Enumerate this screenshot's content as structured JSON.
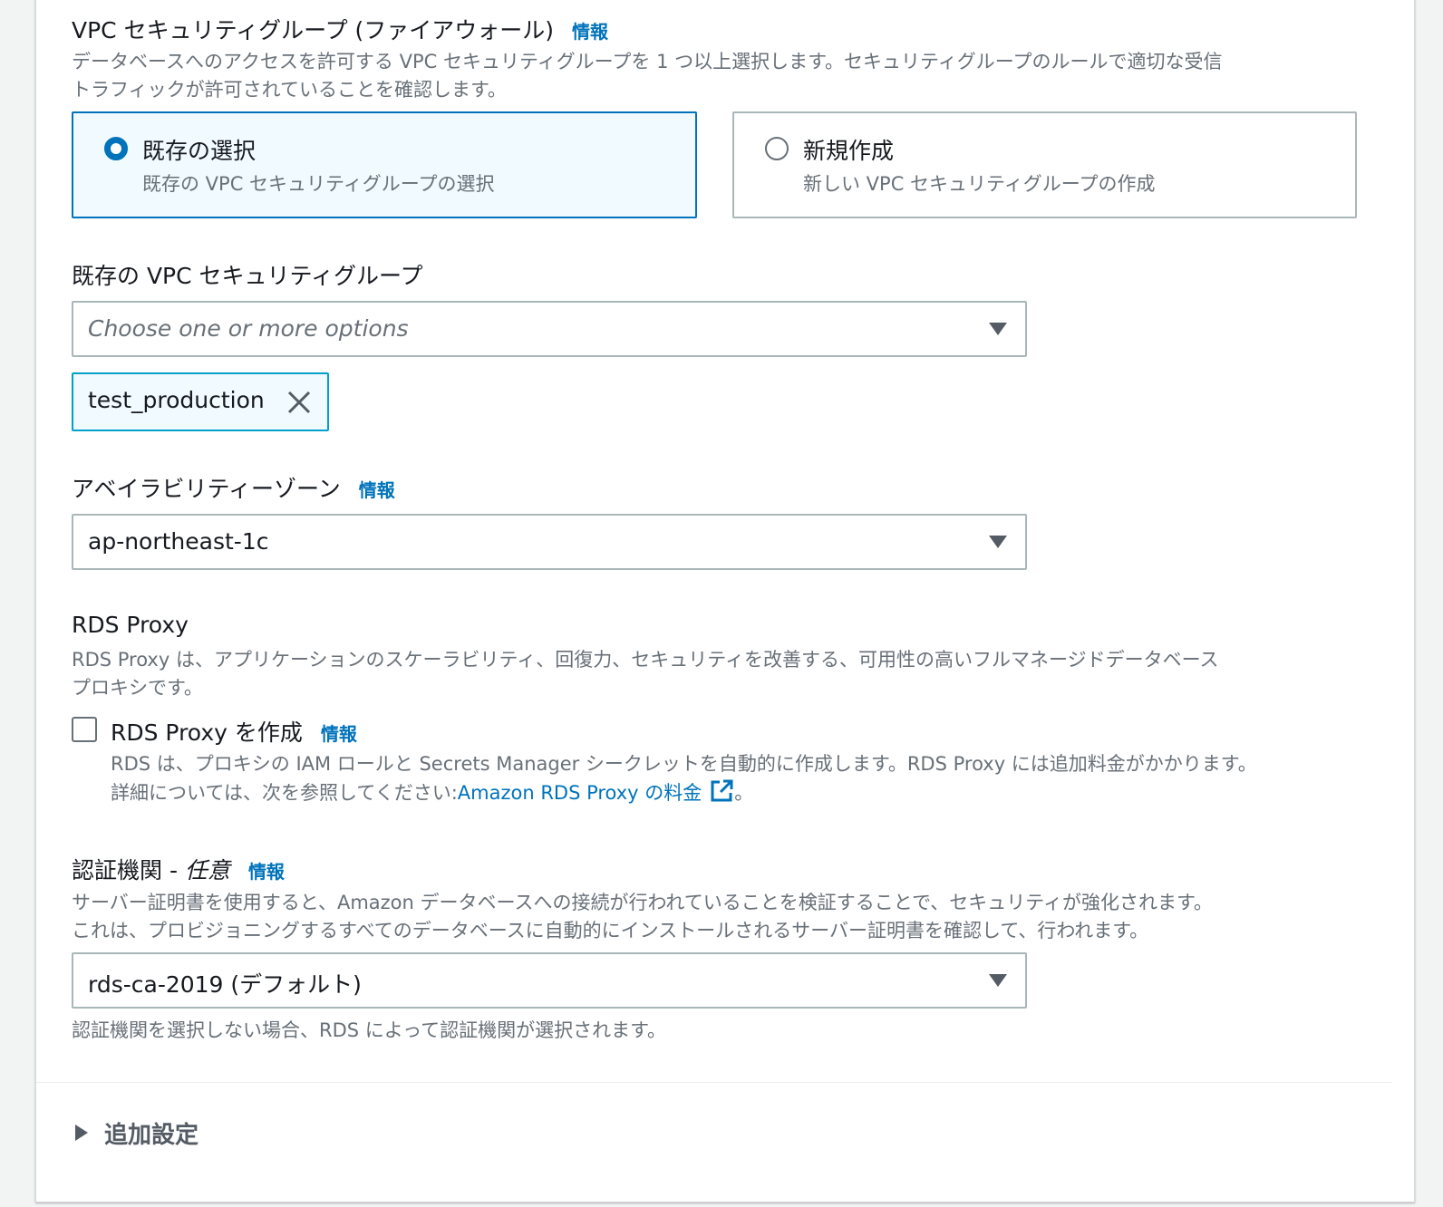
{
  "security_group": {
    "label": "VPC セキュリティグループ (ファイアウォール)",
    "info": "情報",
    "description_line1": "データベースへのアクセスを許可する VPC セキュリティグループを 1 つ以上選択します。セキュリティグループのルールで適切な受信",
    "description_line2": "トラフィックが許可されていることを確認します。",
    "options": [
      {
        "title": "既存の選択",
        "description": "既存の VPC セキュリティグループの選択",
        "selected": true
      },
      {
        "title": "新規作成",
        "description": "新しい VPC セキュリティグループの作成",
        "selected": false
      }
    ]
  },
  "existing_sg": {
    "label": "既存の VPC セキュリティグループ",
    "placeholder": "Choose one or more options",
    "tokens": [
      "test_production"
    ]
  },
  "availability_zone": {
    "label": "アベイラビリティーゾーン",
    "info": "情報",
    "value": "ap-northeast-1c"
  },
  "rds_proxy": {
    "label": "RDS Proxy",
    "description_line1": "RDS Proxy は、アプリケーションのスケーラビリティ、回復力、セキュリティを改善する、可用性の高いフルマネージドデータベース",
    "description_line2": "プロキシです。",
    "checkbox_label": "RDS Proxy を作成",
    "checked": false,
    "info": "情報",
    "checkbox_desc_line1": "RDS は、プロキシの IAM ロールと Secrets Manager シークレットを自動的に作成します。RDS Proxy には追加料金がかかります。",
    "checkbox_desc_prefix": "詳細については、次を参照してください:",
    "link_text": "Amazon RDS Proxy の料金",
    "checkbox_desc_suffix": "。"
  },
  "certificate_authority": {
    "label": "認証機関 - ",
    "optional": "任意",
    "info": "情報",
    "description_line1": "サーバー証明書を使用すると、Amazon データベースへの接続が行われていることを検証することで、セキュリティが強化されます。",
    "description_line2": "これは、プロビジョニングするすべてのデータベースに自動的にインストールされるサーバー証明書を確認して、行われます。",
    "value": "rds-ca-2019 (デフォルト)",
    "hint": "認証機関を選択しない場合、RDS によって認証機関が選択されます。"
  },
  "additional_settings": {
    "label": "追加設定"
  },
  "colors": {
    "link": "#0073bb",
    "selected_border": "#0073bb",
    "selected_bg": "#f1faff",
    "token_border": "#00a1c9",
    "text": "#16191f",
    "secondary_text": "#687078"
  },
  "icons": [
    "radio-selected-icon",
    "radio-unselected-icon",
    "caret-down-icon",
    "close-icon",
    "external-link-icon",
    "caret-right-icon"
  ]
}
